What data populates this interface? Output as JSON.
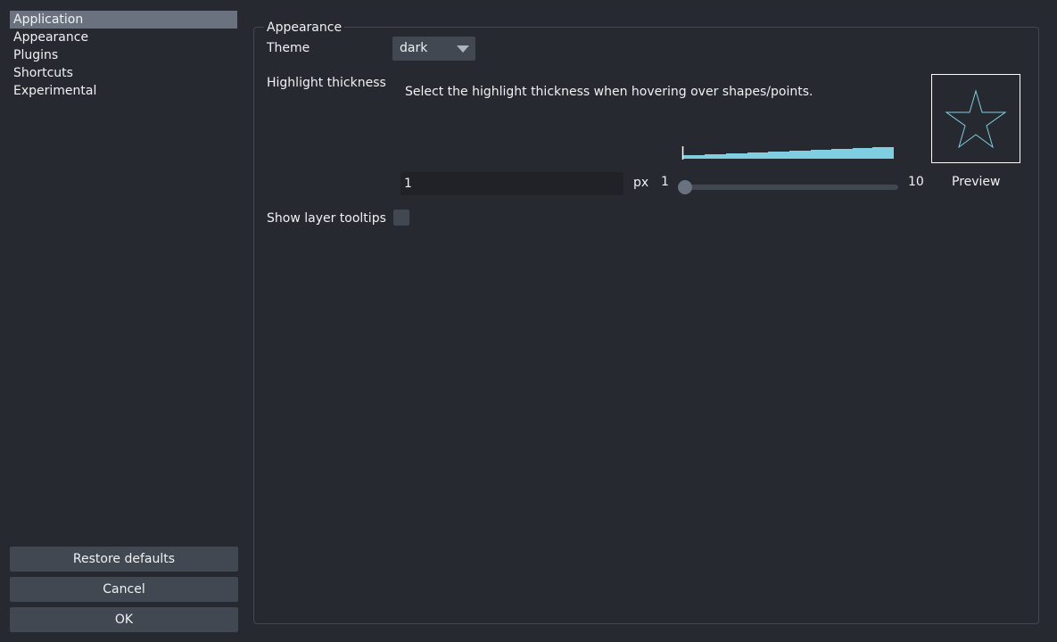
{
  "sidebar": {
    "items": [
      {
        "label": "Application",
        "selected": true
      },
      {
        "label": "Appearance",
        "selected": false
      },
      {
        "label": "Plugins",
        "selected": false
      },
      {
        "label": "Shortcuts",
        "selected": false
      },
      {
        "label": "Experimental",
        "selected": false
      }
    ]
  },
  "buttons": {
    "restore_defaults": "Restore defaults",
    "cancel": "Cancel",
    "ok": "OK"
  },
  "appearance": {
    "group_title": "Appearance",
    "theme": {
      "label": "Theme",
      "value": "dark"
    },
    "highlight": {
      "label": "Highlight thickness",
      "description": "Select the highlight thickness when hovering over shapes/points.",
      "value": "1",
      "unit": "px",
      "min_label": "1",
      "max_label": "10",
      "min": 1,
      "max": 10,
      "current": 1,
      "preview_label": "Preview",
      "preview_shape": "star-icon"
    },
    "layer_tooltips": {
      "label": "Show layer tooltips",
      "checked": false
    }
  },
  "colors": {
    "background": "#262930",
    "foreground": "#414851",
    "highlight": "#6a7280",
    "accent": "#80cee1",
    "text": "#f0f1f2"
  }
}
